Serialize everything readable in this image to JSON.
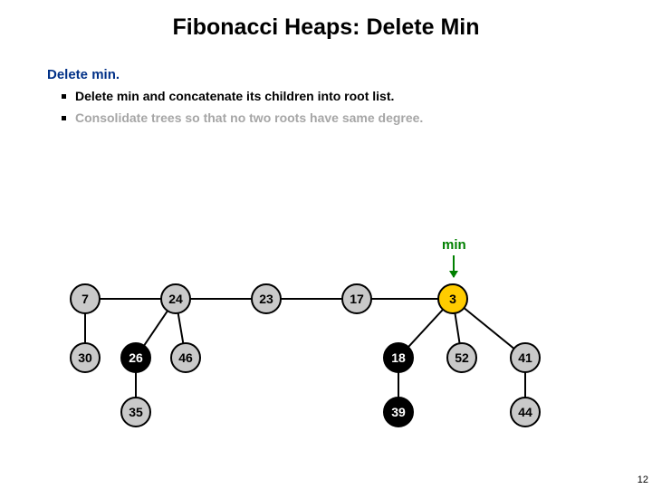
{
  "title": "Fibonacci Heaps:  Delete Min",
  "subtitle": "Delete min.",
  "bullets": {
    "b1": "Delete min and concatenate its children into root list.",
    "b2": "Consolidate trees so that no two roots have same degree."
  },
  "min_label": "min",
  "page_number": "12",
  "nodes": {
    "n7": "7",
    "n24": "24",
    "n23": "23",
    "n17": "17",
    "n3": "3",
    "n30": "30",
    "n26": "26",
    "n46": "46",
    "n18": "18",
    "n52": "52",
    "n41": "41",
    "n35": "35",
    "n39": "39",
    "n44": "44"
  }
}
